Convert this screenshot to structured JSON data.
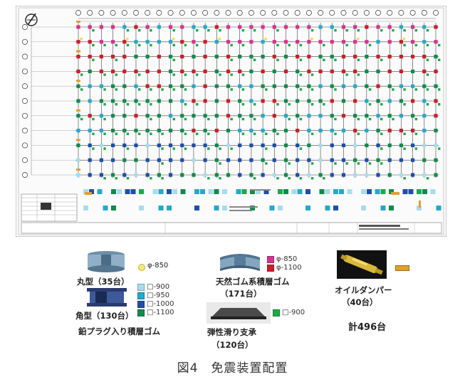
{
  "figure_caption": "図4　免震装置配置",
  "plan": {
    "columns": 32,
    "rows": 11,
    "palette": {
      "round_850": "#f2e24e",
      "sq_900": "#a9dcec",
      "sq_950": "#27a8c8",
      "sq_1000": "#1f4fa8",
      "sq_1100": "#128a4e",
      "nat_850": "#d6338e",
      "nat_1100": "#c8202a",
      "slide_900": "#1ea84a",
      "oil": "#e0a030"
    }
  },
  "legend": {
    "lead_rubber": {
      "round_label": "丸型（35台）",
      "round_size": "φ-850",
      "square_label": "角型（130台）",
      "square_sizes": [
        "□-900",
        "□-950",
        "□-1000",
        "□-1100"
      ],
      "title": "鉛プラグ入り積層ゴム"
    },
    "natural_rubber": {
      "sizes": [
        "φ-850",
        "φ-1100"
      ],
      "title": "天然ゴム系積層ゴム",
      "count": "（171台）"
    },
    "elastic_sliding": {
      "size": "□-900",
      "title": "弾性滑り支承",
      "count": "（120台）"
    },
    "oil_damper": {
      "title": "オイルダンパー",
      "count": "（40台）"
    },
    "total": "計496台"
  }
}
